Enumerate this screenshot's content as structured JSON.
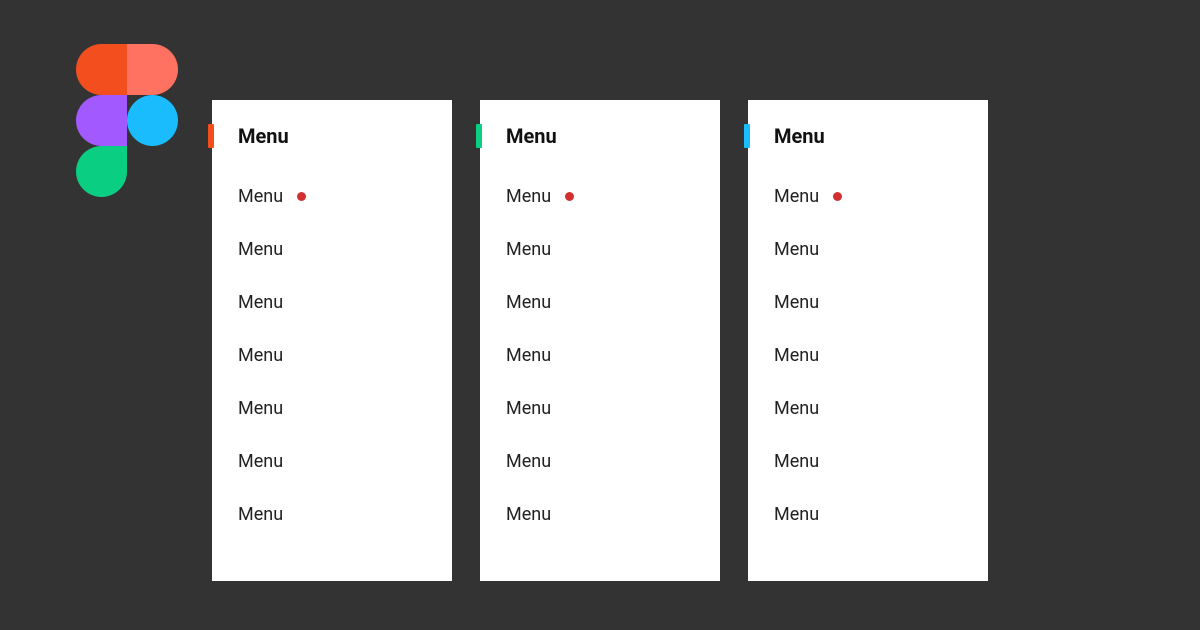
{
  "colors": {
    "dot": "#D23030"
  },
  "panels": [
    {
      "accent_color": "#F24E1E",
      "title": "Menu",
      "items": [
        {
          "label": "Menu",
          "has_dot": true
        },
        {
          "label": "Menu",
          "has_dot": false
        },
        {
          "label": "Menu",
          "has_dot": false
        },
        {
          "label": "Menu",
          "has_dot": false
        },
        {
          "label": "Menu",
          "has_dot": false
        },
        {
          "label": "Menu",
          "has_dot": false
        },
        {
          "label": "Menu",
          "has_dot": false
        }
      ]
    },
    {
      "accent_color": "#0ACF83",
      "title": "Menu",
      "items": [
        {
          "label": "Menu",
          "has_dot": true
        },
        {
          "label": "Menu",
          "has_dot": false
        },
        {
          "label": "Menu",
          "has_dot": false
        },
        {
          "label": "Menu",
          "has_dot": false
        },
        {
          "label": "Menu",
          "has_dot": false
        },
        {
          "label": "Menu",
          "has_dot": false
        },
        {
          "label": "Menu",
          "has_dot": false
        }
      ]
    },
    {
      "accent_color": "#1ABCFE",
      "title": "Menu",
      "items": [
        {
          "label": "Menu",
          "has_dot": true
        },
        {
          "label": "Menu",
          "has_dot": false
        },
        {
          "label": "Menu",
          "has_dot": false
        },
        {
          "label": "Menu",
          "has_dot": false
        },
        {
          "label": "Menu",
          "has_dot": false
        },
        {
          "label": "Menu",
          "has_dot": false
        },
        {
          "label": "Menu",
          "has_dot": false
        }
      ]
    }
  ]
}
